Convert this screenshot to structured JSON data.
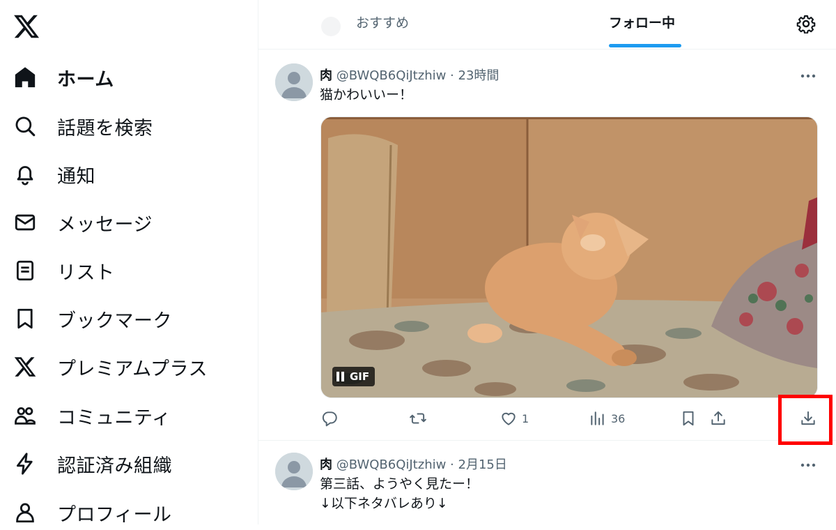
{
  "sidebar": {
    "logo_icon": "x-logo-icon",
    "items": [
      {
        "label": "ホーム",
        "icon": "home-icon",
        "active": true
      },
      {
        "label": "話題を検索",
        "icon": "search-icon"
      },
      {
        "label": "通知",
        "icon": "bell-icon"
      },
      {
        "label": "メッセージ",
        "icon": "envelope-icon"
      },
      {
        "label": "リスト",
        "icon": "list-icon"
      },
      {
        "label": "ブックマーク",
        "icon": "bookmark-icon"
      },
      {
        "label": "プレミアムプラス",
        "icon": "x-logo-icon"
      },
      {
        "label": "コミュニティ",
        "icon": "people-icon"
      },
      {
        "label": "認証済み組織",
        "icon": "lightning-icon"
      },
      {
        "label": "プロフィール",
        "icon": "person-icon"
      }
    ]
  },
  "tabs": {
    "recommended": "おすすめ",
    "following": "フォロー中",
    "active": "following"
  },
  "tweets": [
    {
      "name": "肉",
      "handle": "@BWQB6QiJtzhiw",
      "separator": " · ",
      "time": "23時間",
      "text": "猫かわいいー！",
      "media": {
        "type": "GIF",
        "badge": "GIF"
      },
      "actions": {
        "reply": "",
        "retweet": "",
        "like": "1",
        "views": "36"
      }
    },
    {
      "name": "肉",
      "handle": "@BWQB6QiJtzhiw",
      "separator": " · ",
      "time": "2月15日",
      "text_line1": "第三話、ようやく見たー！",
      "text_line2": "↓以下ネタバレあり↓"
    }
  ],
  "colors": {
    "accent": "#1d9bf0",
    "highlight": "#ff0000",
    "muted": "#536471"
  }
}
